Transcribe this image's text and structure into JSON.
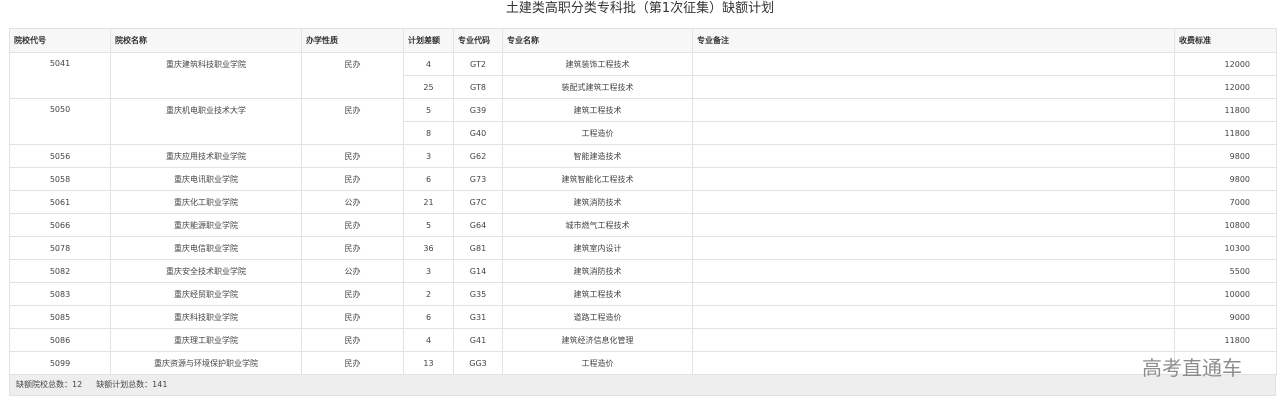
{
  "page": {
    "title": "土建类高职分类专科批（第1次征集）缺额计划"
  },
  "table": {
    "columns": [
      "院校代号",
      "院校名称",
      "办学性质",
      "计划差额",
      "专业代码",
      "专业名称",
      "专业备注",
      "收费标准"
    ],
    "rows": [
      {
        "school_code": "5041",
        "school_name": "重庆建筑科技职业学院",
        "nature": "民办",
        "gap": "4",
        "major_code": "GT2",
        "major_name": "建筑装饰工程技术",
        "remark": "",
        "fee": "12000"
      },
      {
        "school_code": "",
        "school_name": "",
        "nature": "",
        "gap": "25",
        "major_code": "GT8",
        "major_name": "装配式建筑工程技术",
        "remark": "",
        "fee": "12000"
      },
      {
        "school_code": "5050",
        "school_name": "重庆机电职业技术大学",
        "nature": "民办",
        "gap": "5",
        "major_code": "G39",
        "major_name": "建筑工程技术",
        "remark": "",
        "fee": "11800"
      },
      {
        "school_code": "",
        "school_name": "",
        "nature": "",
        "gap": "8",
        "major_code": "G40",
        "major_name": "工程造价",
        "remark": "",
        "fee": "11800"
      },
      {
        "school_code": "5056",
        "school_name": "重庆应用技术职业学院",
        "nature": "民办",
        "gap": "3",
        "major_code": "G62",
        "major_name": "智能建造技术",
        "remark": "",
        "fee": "9800"
      },
      {
        "school_code": "5058",
        "school_name": "重庆电讯职业学院",
        "nature": "民办",
        "gap": "6",
        "major_code": "G73",
        "major_name": "建筑智能化工程技术",
        "remark": "",
        "fee": "9800"
      },
      {
        "school_code": "5061",
        "school_name": "重庆化工职业学院",
        "nature": "公办",
        "gap": "21",
        "major_code": "G7C",
        "major_name": "建筑消防技术",
        "remark": "",
        "fee": "7000"
      },
      {
        "school_code": "5066",
        "school_name": "重庆能源职业学院",
        "nature": "民办",
        "gap": "5",
        "major_code": "G64",
        "major_name": "城市燃气工程技术",
        "remark": "",
        "fee": "10800"
      },
      {
        "school_code": "5078",
        "school_name": "重庆电信职业学院",
        "nature": "民办",
        "gap": "36",
        "major_code": "G81",
        "major_name": "建筑室内设计",
        "remark": "",
        "fee": "10300"
      },
      {
        "school_code": "5082",
        "school_name": "重庆安全技术职业学院",
        "nature": "公办",
        "gap": "3",
        "major_code": "G14",
        "major_name": "建筑消防技术",
        "remark": "",
        "fee": "5500"
      },
      {
        "school_code": "5083",
        "school_name": "重庆经贸职业学院",
        "nature": "民办",
        "gap": "2",
        "major_code": "G35",
        "major_name": "建筑工程技术",
        "remark": "",
        "fee": "10000"
      },
      {
        "school_code": "5085",
        "school_name": "重庆科技职业学院",
        "nature": "民办",
        "gap": "6",
        "major_code": "G31",
        "major_name": "道路工程造价",
        "remark": "",
        "fee": "9000"
      },
      {
        "school_code": "5086",
        "school_name": "重庆理工职业学院",
        "nature": "民办",
        "gap": "4",
        "major_code": "G41",
        "major_name": "建筑经济信息化管理",
        "remark": "",
        "fee": "11800"
      },
      {
        "school_code": "5099",
        "school_name": "重庆资源与环境保护职业学院",
        "nature": "民办",
        "gap": "13",
        "major_code": "GG3",
        "major_name": "工程造价",
        "remark": "",
        "fee": ""
      }
    ]
  },
  "summary": {
    "school_count_label": "缺额院校总数：12",
    "plan_count_label": "缺额计划总数：141"
  },
  "watermark": {
    "text": "高考直通车"
  }
}
